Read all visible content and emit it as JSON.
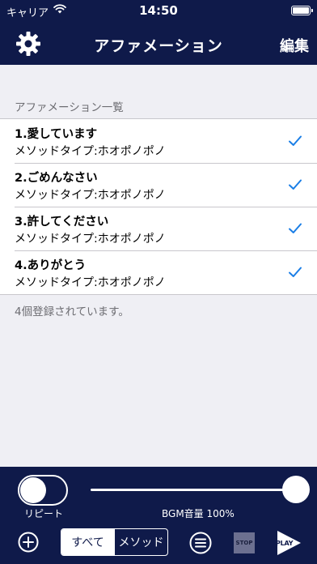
{
  "status_bar": {
    "carrier": "キャリア",
    "time": "14:50",
    "icons": [
      "wifi-icon",
      "battery-icon"
    ]
  },
  "nav": {
    "title": "アファメーション",
    "edit_label": "編集",
    "left_icon": "gear-icon"
  },
  "section": {
    "header": "アファメーション一覧",
    "footer": "4個登録されています。"
  },
  "items": [
    {
      "title": "1.愛しています",
      "subtitle": "メソッドタイプ:ホオポノポノ",
      "checked": true
    },
    {
      "title": "2.ごめんなさい",
      "subtitle": "メソッドタイプ:ホオポノポノ",
      "checked": true
    },
    {
      "title": "3.許してください",
      "subtitle": "メソッドタイプ:ホオポノポノ",
      "checked": true
    },
    {
      "title": "4.ありがとう",
      "subtitle": "メソッドタイプ:ホオポノポノ",
      "checked": true
    }
  ],
  "player": {
    "repeat_label": "リピート",
    "repeat_on": false,
    "volume_label": "BGM音量 100%",
    "volume": 1.0,
    "segments": [
      "すべて",
      "メソッド"
    ],
    "selected_segment": "すべて",
    "stop_label": "STOP",
    "play_label": "PLAY"
  },
  "colors": {
    "bar_background": "#0f1a4a",
    "accent": "#1a7ee6",
    "page_background": "#efeff4"
  }
}
